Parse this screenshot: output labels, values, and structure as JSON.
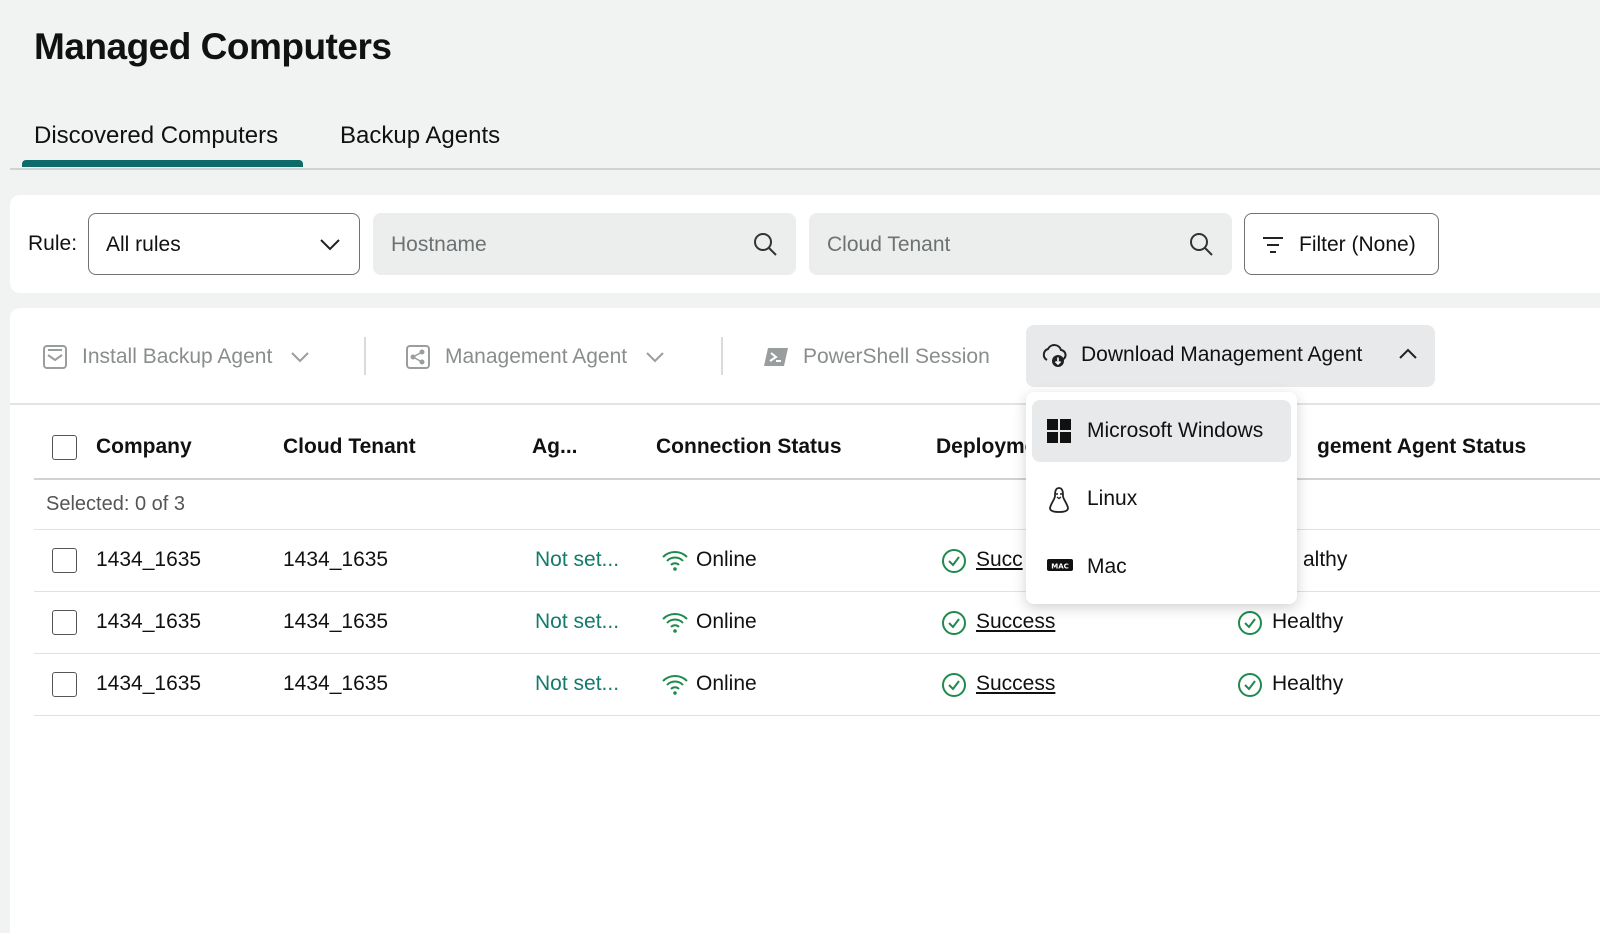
{
  "page": {
    "title": "Managed Computers"
  },
  "tabs": [
    {
      "label": "Discovered Computers",
      "active": true
    },
    {
      "label": "Backup Agents",
      "active": false
    }
  ],
  "filters": {
    "rule_label": "Rule:",
    "rule_value": "All rules",
    "hostname_placeholder": "Hostname",
    "tenant_placeholder": "Cloud Tenant",
    "filter_label": "Filter (None)"
  },
  "toolbar": {
    "install_backup": "Install Backup Agent",
    "management_agent": "Management Agent",
    "powershell": "PowerShell Session",
    "download": "Download Management Agent"
  },
  "dropdown": {
    "items": [
      {
        "label": "Microsoft Windows",
        "icon": "windows-icon",
        "highlighted": true
      },
      {
        "label": "Linux",
        "icon": "linux-icon",
        "highlighted": false
      },
      {
        "label": "Mac",
        "icon": "mac-icon",
        "highlighted": false
      }
    ]
  },
  "table": {
    "columns": [
      "Company",
      "Cloud Tenant",
      "Ag...",
      "Connection Status",
      "Deployme",
      "gement Agent Status"
    ],
    "selected_text": "Selected: 0 of 3",
    "rows": [
      {
        "company": "1434_1635",
        "tenant": "1434_1635",
        "agent": "Not set...",
        "connection": "Online",
        "deployment": "Succ",
        "mgmt_status": "althy"
      },
      {
        "company": "1434_1635",
        "tenant": "1434_1635",
        "agent": "Not set...",
        "connection": "Online",
        "deployment": "Success",
        "mgmt_status": "Healthy"
      },
      {
        "company": "1434_1635",
        "tenant": "1434_1635",
        "agent": "Not set...",
        "connection": "Online",
        "deployment": "Success",
        "mgmt_status": "Healthy"
      }
    ]
  },
  "colors": {
    "accent": "#0f6a6a",
    "success": "#1f8a4c",
    "link": "#157a6e"
  }
}
